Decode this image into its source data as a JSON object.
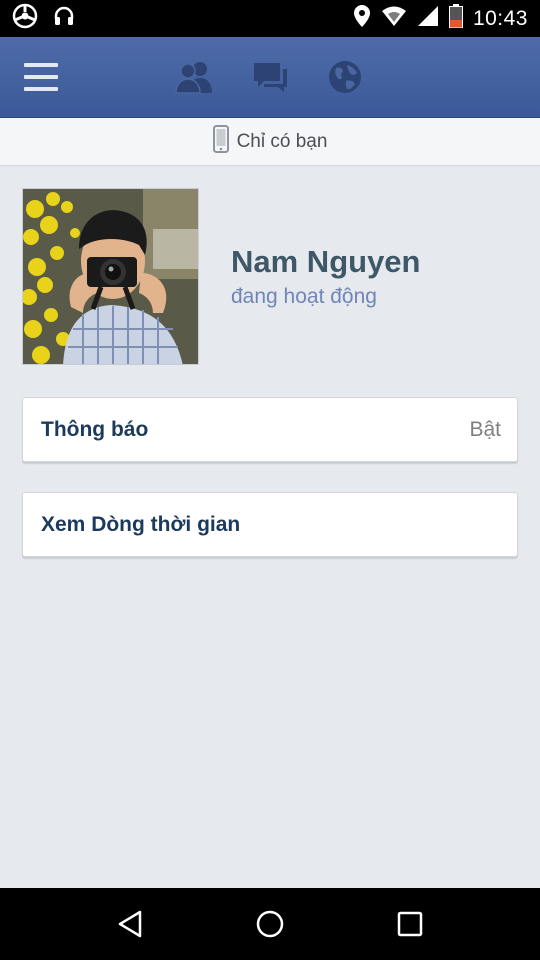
{
  "status_bar": {
    "time": "10:43",
    "icons": [
      "steering-wheel-icon",
      "headset-icon",
      "location-pin-icon",
      "wifi-icon",
      "signal-icon",
      "battery-icon"
    ]
  },
  "top_nav": {
    "icons": [
      "menu-icon",
      "friend-requests-icon",
      "messages-icon",
      "notifications-globe-icon"
    ],
    "colors": {
      "bar": "#3b5998",
      "icon": "#2c4373"
    }
  },
  "audience": {
    "icon": "mobile-phone-icon",
    "label": "Chỉ có bạn"
  },
  "profile": {
    "name": "Nam Nguyen",
    "status": "đang hoạt động"
  },
  "settings": {
    "notifications_label": "Thông báo",
    "notifications_value": "Bật",
    "timeline_label": "Xem Dòng thời gian"
  },
  "system_nav": {
    "icons": [
      "back-icon",
      "home-icon",
      "recents-icon"
    ]
  }
}
